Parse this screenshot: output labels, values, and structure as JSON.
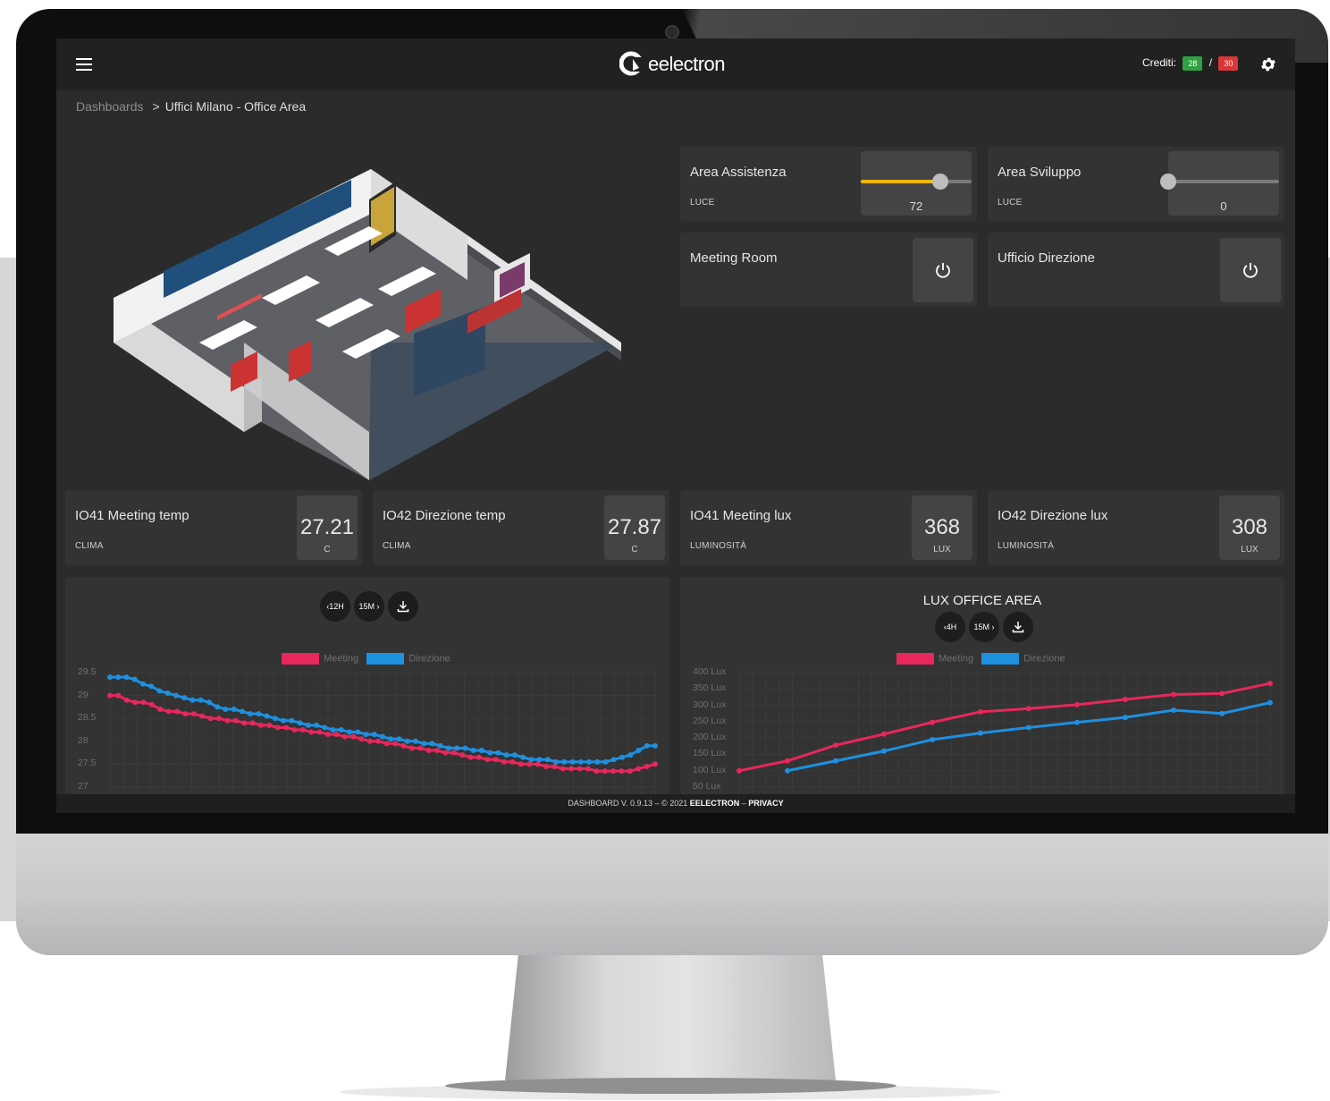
{
  "header": {
    "brand": "eelectron",
    "credits_label": "Crediti:",
    "credits_used": "28",
    "credits_sep": "/",
    "credits_total": "30",
    "colors": {
      "green": "#2fa043",
      "red": "#d93636"
    }
  },
  "breadcrumb": {
    "root": "Dashboards",
    "separator": ">",
    "current": "Uffici Milano - Office Area"
  },
  "controls": {
    "area_assistenza": {
      "title": "Area Assistenza",
      "subtitle": "LUCE",
      "value": "72",
      "level": 0.72
    },
    "area_sviluppo": {
      "title": "Area Sviluppo",
      "subtitle": "LUCE",
      "value": "0",
      "level": 0
    },
    "meeting_room": {
      "title": "Meeting Room",
      "icon": "power-icon"
    },
    "ufficio_direzione": {
      "title": "Ufficio Direzione",
      "icon": "power-icon"
    }
  },
  "sensors": [
    {
      "title": "IO41 Meeting temp",
      "subtitle": "CLIMA",
      "value": "27.21",
      "unit": "C"
    },
    {
      "title": "IO42 Direzione temp",
      "subtitle": "CLIMA",
      "value": "27.87",
      "unit": "C"
    },
    {
      "title": "IO41 Meeting lux",
      "subtitle": "LUMINOSITÀ",
      "value": "368",
      "unit": "LUX"
    },
    {
      "title": "IO42 Direzione lux",
      "subtitle": "LUMINOSITÀ",
      "value": "308",
      "unit": "LUX"
    }
  ],
  "temp_chart": {
    "buttons": {
      "range": "‹12H",
      "step": "15M ›"
    },
    "legend": [
      "Meeting",
      "Direzione"
    ]
  },
  "lux_chart": {
    "title": "LUX OFFICE AREA",
    "buttons": {
      "range": "‹4H",
      "step": "15M ›"
    },
    "legend": [
      "Meeting",
      "Direzione"
    ]
  },
  "chart_data": [
    {
      "type": "line",
      "title": "",
      "yticks": [
        "29.5",
        "29",
        "28.5",
        "28",
        "27.5",
        "27"
      ],
      "ylim": [
        27,
        29.5
      ],
      "grid": true,
      "legend_position": "top-center",
      "series": [
        {
          "name": "Meeting",
          "color": "#e8275c",
          "values": [
            29.0,
            29.0,
            28.9,
            28.85,
            28.85,
            28.8,
            28.7,
            28.65,
            28.65,
            28.6,
            28.6,
            28.55,
            28.5,
            28.5,
            28.45,
            28.45,
            28.4,
            28.4,
            28.35,
            28.35,
            28.3,
            28.3,
            28.25,
            28.25,
            28.2,
            28.2,
            28.15,
            28.15,
            28.1,
            28.1,
            28.05,
            28.0,
            28.0,
            27.95,
            27.95,
            27.9,
            27.85,
            27.85,
            27.8,
            27.8,
            27.75,
            27.75,
            27.7,
            27.65,
            27.65,
            27.6,
            27.6,
            27.55,
            27.55,
            27.5,
            27.5,
            27.5,
            27.45,
            27.45,
            27.4,
            27.4,
            27.4,
            27.4,
            27.35,
            27.35,
            27.35,
            27.35,
            27.35,
            27.4,
            27.45,
            27.5
          ]
        },
        {
          "name": "Direzione",
          "color": "#1e90e0",
          "values": [
            29.4,
            29.4,
            29.4,
            29.35,
            29.25,
            29.2,
            29.1,
            29.05,
            29.0,
            28.95,
            28.9,
            28.9,
            28.85,
            28.75,
            28.7,
            28.7,
            28.65,
            28.6,
            28.6,
            28.55,
            28.5,
            28.45,
            28.45,
            28.4,
            28.35,
            28.35,
            28.3,
            28.25,
            28.25,
            28.2,
            28.2,
            28.15,
            28.15,
            28.1,
            28.05,
            28.05,
            28.0,
            28.0,
            27.95,
            27.95,
            27.9,
            27.85,
            27.85,
            27.85,
            27.8,
            27.8,
            27.75,
            27.75,
            27.7,
            27.7,
            27.65,
            27.6,
            27.6,
            27.6,
            27.55,
            27.55,
            27.55,
            27.55,
            27.55,
            27.55,
            27.55,
            27.6,
            27.65,
            27.7,
            27.8,
            27.9,
            27.9
          ]
        }
      ]
    },
    {
      "type": "line",
      "title": "LUX OFFICE AREA",
      "yticks": [
        "400 Lux",
        "350 Lux",
        "300 Lux",
        "250 Lux",
        "200 Lux",
        "150 Lux",
        "100 Lux",
        "50 Lux"
      ],
      "ylim": [
        50,
        400
      ],
      "grid": true,
      "legend_position": "top-center",
      "series": [
        {
          "name": "Meeting",
          "color": "#e8275c",
          "values": [
            100,
            130,
            178,
            212,
            248,
            280,
            290,
            302,
            318,
            333,
            336,
            367
          ]
        },
        {
          "name": "Direzione",
          "color": "#1e90e0",
          "values": [
            null,
            100,
            130,
            160,
            195,
            215,
            232,
            248,
            263,
            285,
            275,
            308
          ]
        }
      ]
    }
  ],
  "footer": {
    "prefix": "DASHBOARD V. 0.9.13 – © 2021",
    "brand": "EELECTRON",
    "sep": "–",
    "privacy": "PRIVACY"
  }
}
